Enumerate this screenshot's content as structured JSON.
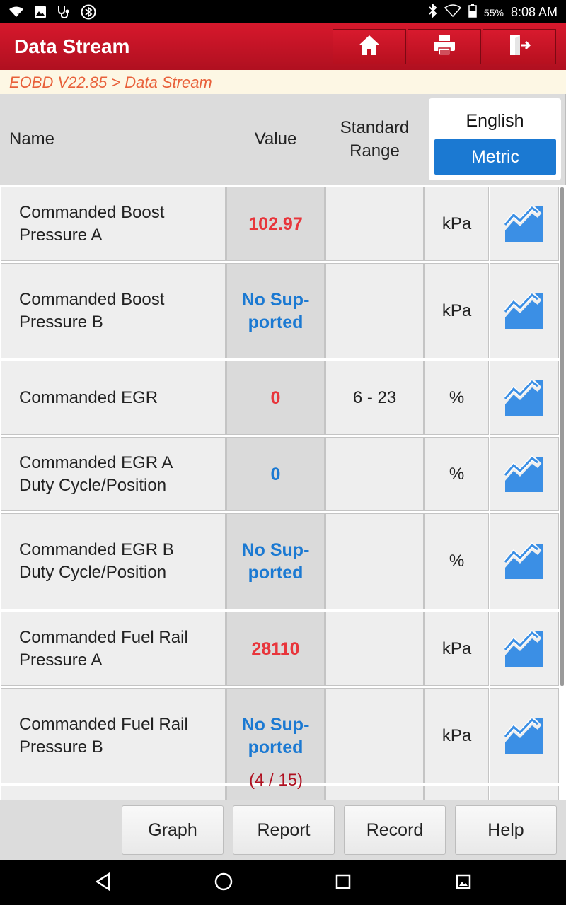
{
  "status_bar": {
    "battery": "55%",
    "time": "8:08 AM"
  },
  "app_bar": {
    "title": "Data Stream"
  },
  "breadcrumb": "EOBD V22.85 > Data Stream",
  "header": {
    "name": "Name",
    "value": "Value",
    "range_line1": "Standard",
    "range_line2": "Range",
    "unit_english": "English",
    "unit_metric": "Metric"
  },
  "rows": [
    {
      "name_l1": "Commanded Boost",
      "name_l2": "Pressure A",
      "value_l1": "102.97",
      "value_l2": "",
      "range": "",
      "unit": "kPa",
      "value_color": "#e8353b"
    },
    {
      "name_l1": "Commanded Boost",
      "name_l2": "Pressure B",
      "value_l1": "No Sup-",
      "value_l2": "ported",
      "range": "",
      "unit": "kPa",
      "value_color": "#1b79d2"
    },
    {
      "name_l1": "Commanded EGR",
      "name_l2": "",
      "value_l1": "0",
      "value_l2": "",
      "range": "6 - 23",
      "unit": "%",
      "value_color": "#e8353b"
    },
    {
      "name_l1": "Commanded EGR A",
      "name_l2": "Duty Cycle/Position",
      "value_l1": "0",
      "value_l2": "",
      "range": "",
      "unit": "%",
      "value_color": "#1b79d2"
    },
    {
      "name_l1": "Commanded EGR B",
      "name_l2": "Duty Cycle/Position",
      "value_l1": "No Sup-",
      "value_l2": "ported",
      "range": "",
      "unit": "%",
      "value_color": "#1b79d2"
    },
    {
      "name_l1": "Commanded Fuel Rail",
      "name_l2": "Pressure A",
      "value_l1": "28110",
      "value_l2": "",
      "range": "",
      "unit": "kPa",
      "value_color": "#e8353b"
    },
    {
      "name_l1": "Commanded Fuel Rail",
      "name_l2": "Pressure B",
      "value_l1": "No Sup-",
      "value_l2": "ported",
      "range": "",
      "unit": "kPa",
      "value_color": "#1b79d2"
    }
  ],
  "pager": "(4 / 15)",
  "bottom_buttons": {
    "graph": "Graph",
    "report": "Report",
    "record": "Record",
    "help": "Help"
  }
}
